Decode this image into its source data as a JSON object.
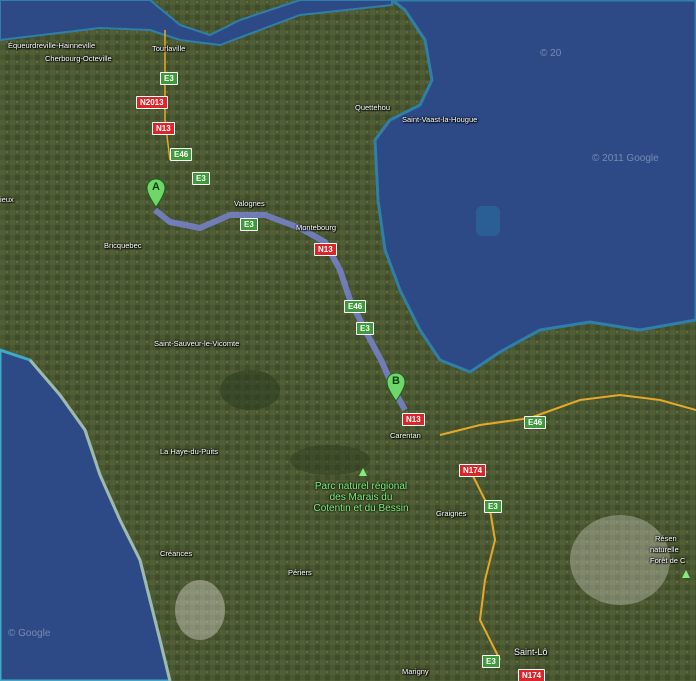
{
  "map": {
    "type": "satellite",
    "colors": {
      "sea": "#2d4a86",
      "land": "#47552f",
      "route": "#7a86d8",
      "n_road": "#d8262b",
      "e_road": "#3e9a3a"
    },
    "copyright": "© 2011 Google",
    "copyright_tl": "© 20",
    "copyright_bl": "© Google"
  },
  "markers": [
    {
      "label": "A",
      "name": "start"
    },
    {
      "label": "B",
      "name": "end"
    }
  ],
  "places": {
    "equeurdreville": "Équeurdreville-Hainneville",
    "tourlaville": "Tourlaville",
    "cherbourg": "Cherbourg-Octeville",
    "quettehou": "Quettehou",
    "saint_vaast": "Saint-Vaast-la-Hougue",
    "valognes": "Valognes",
    "montebourg": "Montebourg",
    "bricquebec": "Bricquebec",
    "eux": "ieux",
    "saint_sauveur": "Saint-Sauveur-le-Vicomte",
    "carentan": "Carentan",
    "la_haye": "La Haye-du-Puits",
    "graignes": "Graignes",
    "creances": "Créances",
    "periers": "Périers",
    "marigny": "Marigny",
    "saint_lo": "Saint-Lô",
    "reserve_1": "Résen",
    "reserve_2": "naturelle",
    "reserve_3": "Forêt de C"
  },
  "park": {
    "line1": "Parc naturel régional",
    "line2": "des Marais du",
    "line3": "Cotentin et du Bessin"
  },
  "roads": {
    "e3_1": "E3",
    "n2013": "N2013",
    "n13_1": "N13",
    "e46_1": "E46",
    "e3_2": "E3",
    "e3_3": "E3",
    "n13_2": "N13",
    "e46_2": "E46",
    "e3_4": "E3",
    "n13_3": "N13",
    "e46_3": "E46",
    "n174_1": "N174",
    "e3_5": "E3",
    "e3_6": "E3",
    "n174_2": "N174"
  }
}
